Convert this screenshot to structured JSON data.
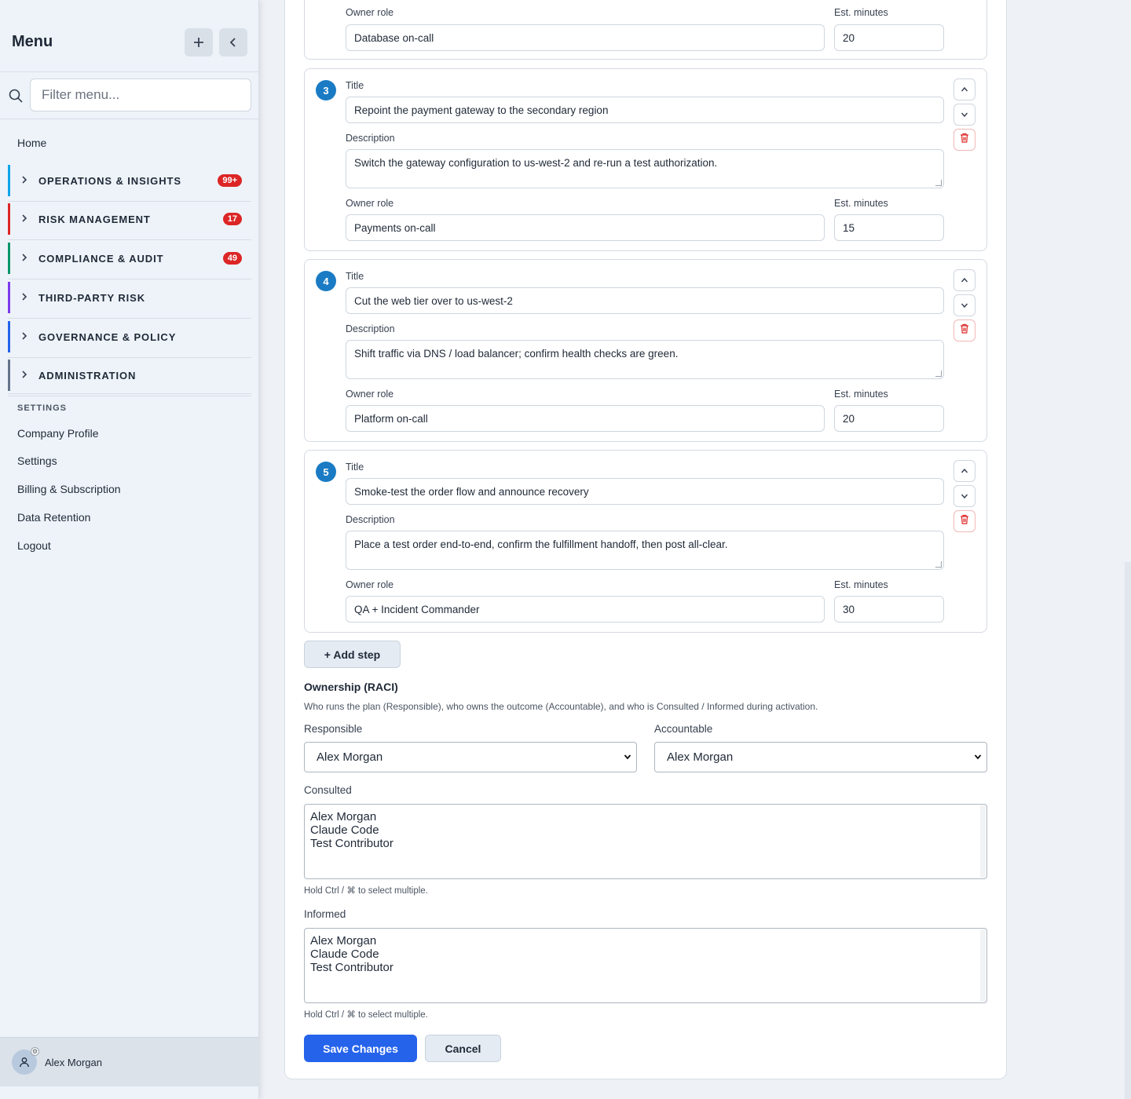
{
  "sidebar": {
    "title": "Menu",
    "add_icon": "plus-icon",
    "collapse_icon": "chevron-left-icon",
    "search_placeholder": "Filter menu...",
    "home": "Home",
    "sections": [
      {
        "label": "OPERATIONS & INSIGHTS",
        "badge": "99+",
        "color": "#0ea5e9"
      },
      {
        "label": "RISK MANAGEMENT",
        "badge": "17",
        "color": "#dc2626"
      },
      {
        "label": "COMPLIANCE & AUDIT",
        "badge": "49",
        "color": "#059669"
      },
      {
        "label": "THIRD-PARTY RISK",
        "badge": "",
        "color": "#7c3aed"
      },
      {
        "label": "GOVERNANCE & POLICY",
        "badge": "",
        "color": "#2563eb"
      },
      {
        "label": "ADMINISTRATION",
        "badge": "",
        "color": "#64748b"
      }
    ],
    "settings_heading": "SETTINGS",
    "settings_items": [
      "Company Profile",
      "Settings",
      "Billing & Subscription",
      "Data Retention",
      "Logout"
    ],
    "user_name": "Alex Morgan"
  },
  "labels": {
    "title": "Title",
    "description": "Description",
    "owner_role": "Owner role",
    "est_minutes": "Est. minutes"
  },
  "step2_partial": {
    "owner_role": "Database on-call",
    "est_minutes": "20"
  },
  "steps": [
    {
      "number": "3",
      "title": "Repoint the payment gateway to the secondary region",
      "description": "Switch the gateway configuration to us-west-2 and re-run a test authorization.",
      "owner_role": "Payments on-call",
      "est_minutes": "15"
    },
    {
      "number": "4",
      "title": "Cut the web tier over to us-west-2",
      "description": "Shift traffic via DNS / load balancer; confirm health checks are green.",
      "owner_role": "Platform on-call",
      "est_minutes": "20"
    },
    {
      "number": "5",
      "title": "Smoke-test the order flow and announce recovery",
      "description": "Place a test order end-to-end, confirm the fulfillment handoff, then post all-clear.",
      "owner_role": "QA + Incident Commander",
      "est_minutes": "30"
    }
  ],
  "add_step_label": "+ Add step",
  "raci": {
    "title": "Ownership (RACI)",
    "description": "Who runs the plan (Responsible), who owns the outcome (Accountable), and who is Consulted / Informed during activation.",
    "responsible_label": "Responsible",
    "responsible_value": "Alex Morgan",
    "accountable_label": "Accountable",
    "accountable_value": "Alex Morgan",
    "consulted_label": "Consulted",
    "consulted_options": [
      "Alex Morgan",
      "Claude Code",
      "Test Contributor"
    ],
    "informed_label": "Informed",
    "informed_options": [
      "Alex Morgan",
      "Claude Code",
      "Test Contributor"
    ],
    "hint": "Hold Ctrl / ⌘ to select multiple."
  },
  "actions": {
    "save": "Save Changes",
    "cancel": "Cancel"
  }
}
